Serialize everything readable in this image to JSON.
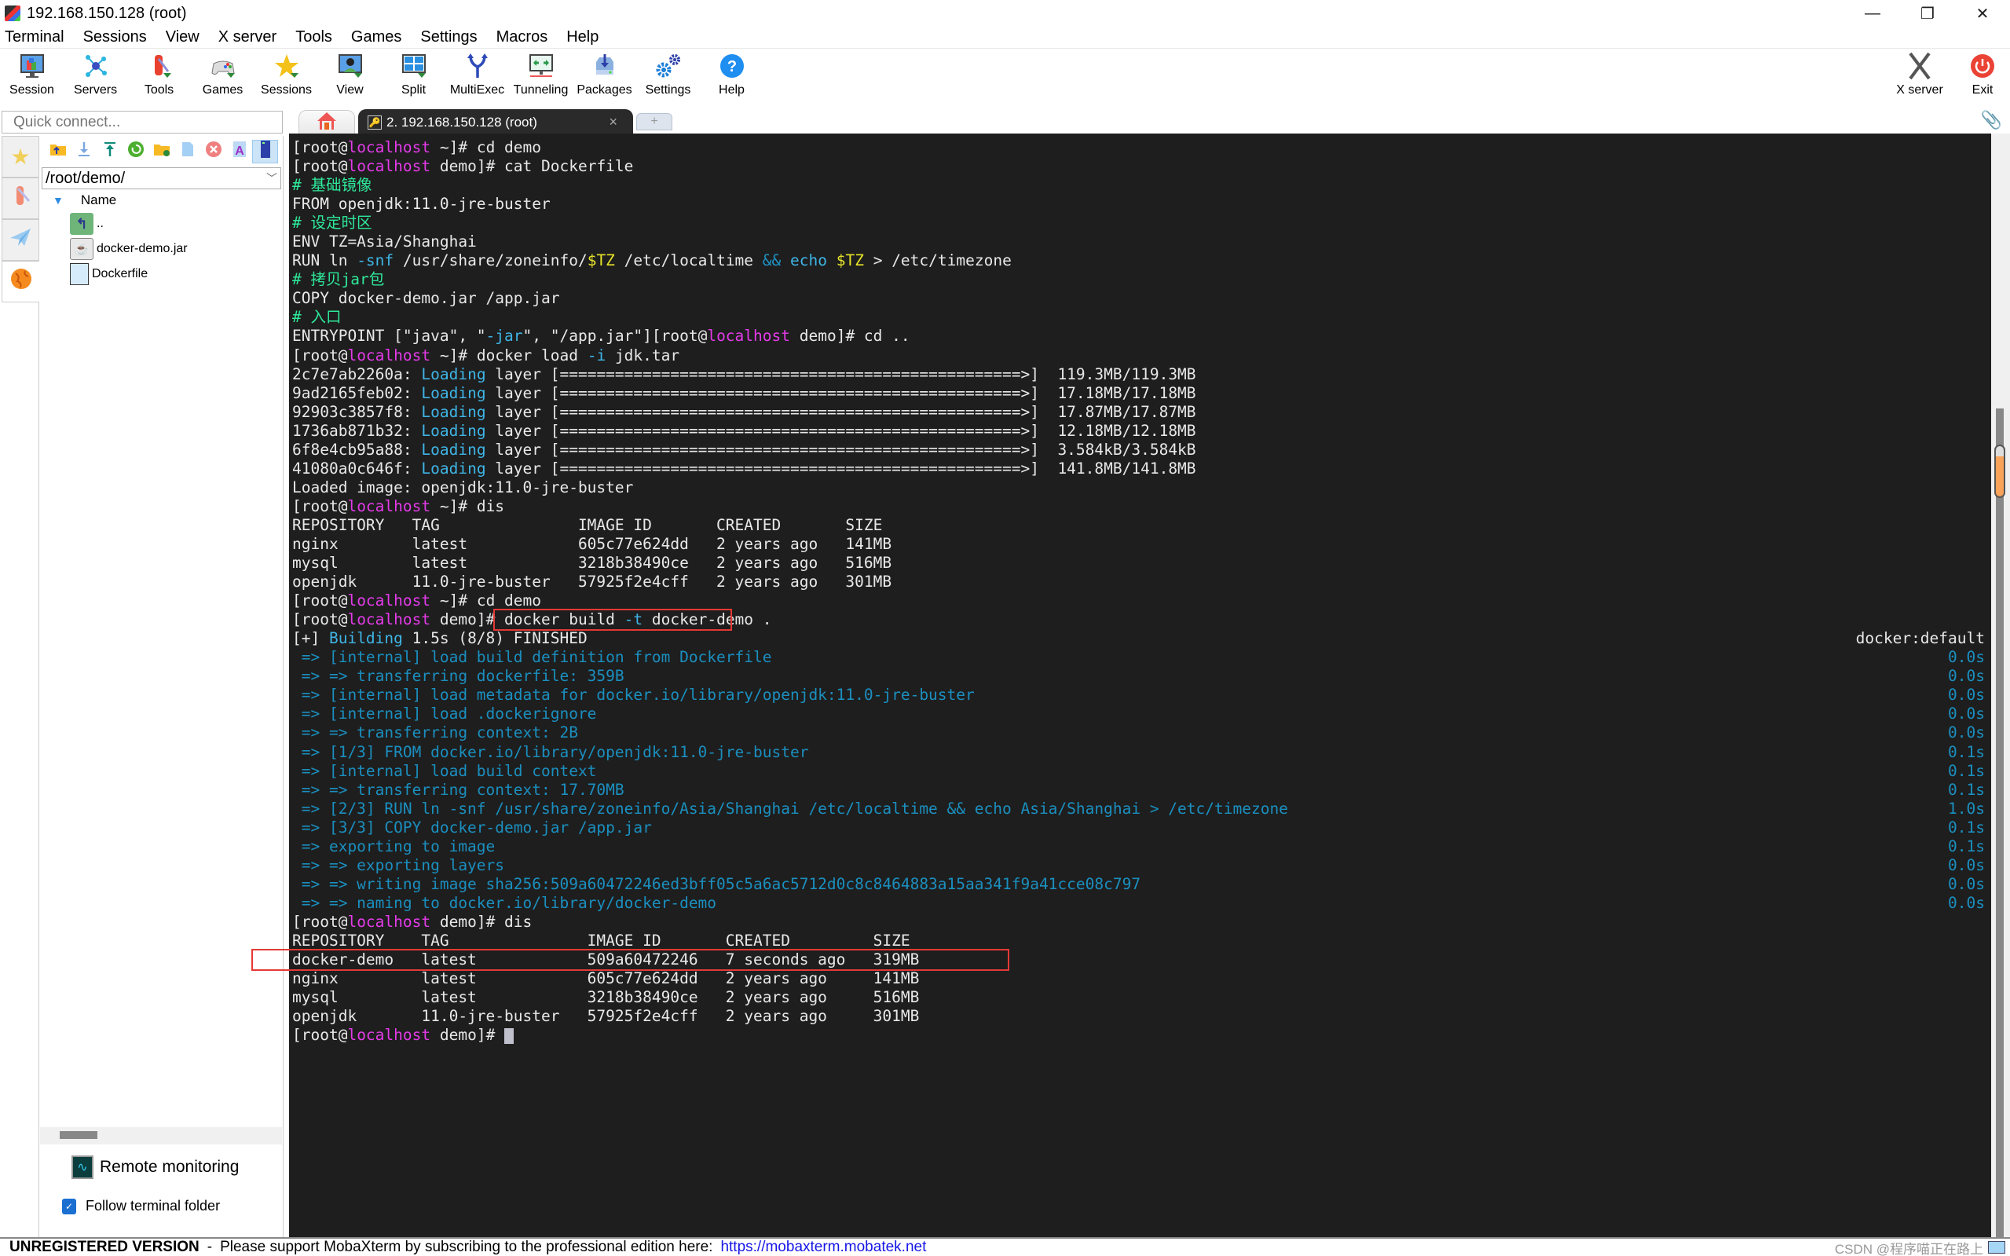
{
  "window": {
    "title": "192.168.150.128 (root)",
    "controls": {
      "minimize": "—",
      "restore": "❐",
      "close": "✕"
    }
  },
  "menu": [
    "Terminal",
    "Sessions",
    "View",
    "X server",
    "Tools",
    "Games",
    "Settings",
    "Macros",
    "Help"
  ],
  "toolbar": {
    "items": [
      {
        "label": "Session",
        "icon": "session-icon"
      },
      {
        "label": "Servers",
        "icon": "servers-icon"
      },
      {
        "label": "Tools",
        "icon": "tools-icon"
      },
      {
        "label": "Games",
        "icon": "games-icon"
      },
      {
        "label": "Sessions",
        "icon": "star-icon"
      },
      {
        "label": "View",
        "icon": "view-icon"
      },
      {
        "label": "Split",
        "icon": "split-icon"
      },
      {
        "label": "MultiExec",
        "icon": "multiexec-icon"
      },
      {
        "label": "Tunneling",
        "icon": "tunneling-icon"
      },
      {
        "label": "Packages",
        "icon": "packages-icon"
      },
      {
        "label": "Settings",
        "icon": "settings-icon"
      },
      {
        "label": "Help",
        "icon": "help-icon"
      }
    ],
    "right": [
      {
        "label": "X server",
        "icon": "x-server-icon"
      },
      {
        "label": "Exit",
        "icon": "power-icon"
      }
    ]
  },
  "quick_connect": {
    "placeholder": "Quick connect..."
  },
  "tabs": {
    "home_icon": "home-icon",
    "session_tab": {
      "label": "2. 192.168.150.128 (root)",
      "close": "×"
    },
    "new_tab": "+"
  },
  "sftp": {
    "path": "/root/demo/",
    "column_header": "Name",
    "files": [
      {
        "name": "..",
        "type": "parent-folder"
      },
      {
        "name": "docker-demo.jar",
        "type": "jar"
      },
      {
        "name": "Dockerfile",
        "type": "file"
      }
    ],
    "remote_monitoring": "Remote monitoring",
    "follow_terminal_folder": {
      "label": "Follow terminal folder",
      "checked": true
    }
  },
  "terminal": {
    "prompt_user": "root",
    "prompt_host": "localhost",
    "lines": [
      {
        "segs": [
          [
            "[root@",
            ""
          ],
          [
            "localhost",
            "host"
          ],
          [
            " ~]# cd demo",
            ""
          ]
        ]
      },
      {
        "segs": [
          [
            "[root@",
            ""
          ],
          [
            "localhost",
            "host"
          ],
          [
            " demo]# cat Dockerfile",
            ""
          ]
        ]
      },
      {
        "segs": [
          [
            "# 基础镜像",
            "cmt"
          ]
        ]
      },
      {
        "segs": [
          [
            "FROM openjdk:11.0-jre-buster",
            ""
          ]
        ]
      },
      {
        "segs": [
          [
            "# 设定时区",
            "cmt"
          ]
        ]
      },
      {
        "segs": [
          [
            "ENV TZ=Asia/Shanghai",
            ""
          ]
        ]
      },
      {
        "segs": [
          [
            "RUN ln ",
            ""
          ],
          [
            "-snf",
            "cyan"
          ],
          [
            " /usr/share/zoneinfo/",
            ""
          ],
          [
            "$TZ",
            "var"
          ],
          [
            " /etc/localtime ",
            ""
          ],
          [
            "&&",
            "blue"
          ],
          [
            " ",
            ""
          ],
          [
            "echo",
            "cyan"
          ],
          [
            " ",
            ""
          ],
          [
            "$TZ",
            "var"
          ],
          [
            " > /etc/timezone",
            ""
          ]
        ]
      },
      {
        "segs": [
          [
            "# 拷贝",
            "cmt"
          ],
          [
            "jar",
            "cmt"
          ],
          [
            "包",
            "cmt"
          ]
        ]
      },
      {
        "segs": [
          [
            "COPY docker-demo.jar /app.jar",
            ""
          ]
        ]
      },
      {
        "segs": [
          [
            "# 入口",
            "cmt"
          ]
        ]
      },
      {
        "segs": [
          [
            "ENTRYPOINT [\"java\", \"",
            ""
          ],
          [
            "-jar",
            "cyan"
          ],
          [
            "\", \"/app.jar\"][root@",
            ""
          ],
          [
            "localhost",
            "host"
          ],
          [
            " demo]# cd ..",
            ""
          ]
        ]
      },
      {
        "segs": [
          [
            "[root@",
            ""
          ],
          [
            "localhost",
            "host"
          ],
          [
            " ~]# docker load ",
            ""
          ],
          [
            "-i",
            "cyan"
          ],
          [
            " jdk.tar",
            ""
          ]
        ]
      },
      {
        "segs": [
          [
            "2c7e7ab2260a: ",
            ""
          ],
          [
            "Loading",
            "cyan"
          ],
          [
            " layer [==================================================>]  119.3MB/119.3MB",
            ""
          ]
        ]
      },
      {
        "segs": [
          [
            "9ad2165feb02: ",
            ""
          ],
          [
            "Loading",
            "cyan"
          ],
          [
            " layer [==================================================>]  17.18MB/17.18MB",
            ""
          ]
        ]
      },
      {
        "segs": [
          [
            "92903c3857f8: ",
            ""
          ],
          [
            "Loading",
            "cyan"
          ],
          [
            " layer [==================================================>]  17.87MB/17.87MB",
            ""
          ]
        ]
      },
      {
        "segs": [
          [
            "1736ab871b32: ",
            ""
          ],
          [
            "Loading",
            "cyan"
          ],
          [
            " layer [==================================================>]  12.18MB/12.18MB",
            ""
          ]
        ]
      },
      {
        "segs": [
          [
            "6f8e4cb95a88: ",
            ""
          ],
          [
            "Loading",
            "cyan"
          ],
          [
            " layer [==================================================>]  3.584kB/3.584kB",
            ""
          ]
        ]
      },
      {
        "segs": [
          [
            "41080a0c646f: ",
            ""
          ],
          [
            "Loading",
            "cyan"
          ],
          [
            " layer [==================================================>]  141.8MB/141.8MB",
            ""
          ]
        ]
      },
      {
        "segs": [
          [
            "Loaded image: openjdk:11.0-jre-buster",
            ""
          ]
        ]
      },
      {
        "segs": [
          [
            "[root@",
            ""
          ],
          [
            "localhost",
            "host"
          ],
          [
            " ~]# dis",
            ""
          ]
        ]
      },
      {
        "segs": [
          [
            "REPOSITORY   TAG               IMAGE ID       CREATED       SIZE",
            ""
          ]
        ]
      },
      {
        "segs": [
          [
            "nginx        latest            605c77e624dd   2 years ago   141MB",
            ""
          ]
        ]
      },
      {
        "segs": [
          [
            "mysql        latest            3218b38490ce   2 years ago   516MB",
            ""
          ]
        ]
      },
      {
        "segs": [
          [
            "openjdk      11.0-jre-buster   57925f2e4cff   2 years ago   301MB",
            ""
          ]
        ]
      },
      {
        "segs": [
          [
            "[root@",
            ""
          ],
          [
            "localhost",
            "host"
          ],
          [
            " ~]# cd demo",
            ""
          ]
        ]
      },
      {
        "segs": [
          [
            "[root@",
            ""
          ],
          [
            "localhost",
            "host"
          ],
          [
            " demo]# docker build ",
            ""
          ],
          [
            "-t",
            "cyan"
          ],
          [
            " docker-demo .",
            ""
          ]
        ],
        "highlight": "build-command"
      },
      {
        "segs": [
          [
            "[+] ",
            ""
          ],
          [
            "Building",
            "cyan"
          ],
          [
            " 1.5s (8/8) FINISHED",
            ""
          ]
        ],
        "right": [
          "docker:default",
          ""
        ]
      },
      {
        "segs": [
          [
            " => [internal] load build definition from Dockerfile",
            "step"
          ]
        ],
        "right": [
          "0.0s",
          "step"
        ]
      },
      {
        "segs": [
          [
            " => => transferring dockerfile: 359B",
            "step"
          ]
        ],
        "right": [
          "0.0s",
          "step"
        ]
      },
      {
        "segs": [
          [
            " => [internal] load metadata for docker.io/library/openjdk:11.0-jre-buster",
            "step"
          ]
        ],
        "right": [
          "0.0s",
          "step"
        ]
      },
      {
        "segs": [
          [
            " => [internal] load .dockerignore",
            "step"
          ]
        ],
        "right": [
          "0.0s",
          "step"
        ]
      },
      {
        "segs": [
          [
            " => => transferring context: 2B",
            "step"
          ]
        ],
        "right": [
          "0.0s",
          "step"
        ]
      },
      {
        "segs": [
          [
            " => [1/3] FROM docker.io/library/openjdk:11.0-jre-buster",
            "step"
          ]
        ],
        "right": [
          "0.1s",
          "step"
        ]
      },
      {
        "segs": [
          [
            " => [internal] load build context",
            "step"
          ]
        ],
        "right": [
          "0.1s",
          "step"
        ]
      },
      {
        "segs": [
          [
            " => => transferring context: 17.70MB",
            "step"
          ]
        ],
        "right": [
          "0.1s",
          "step"
        ]
      },
      {
        "segs": [
          [
            " => [2/3] RUN ln -snf /usr/share/zoneinfo/Asia/Shanghai /etc/localtime && echo Asia/Shanghai > /etc/timezone",
            "step"
          ]
        ],
        "right": [
          "1.0s",
          "step"
        ]
      },
      {
        "segs": [
          [
            " => [3/3] COPY docker-demo.jar /app.jar",
            "step"
          ]
        ],
        "right": [
          "0.1s",
          "step"
        ]
      },
      {
        "segs": [
          [
            " => exporting to image",
            "step"
          ]
        ],
        "right": [
          "0.1s",
          "step"
        ]
      },
      {
        "segs": [
          [
            " => => exporting layers",
            "step"
          ]
        ],
        "right": [
          "0.0s",
          "step"
        ]
      },
      {
        "segs": [
          [
            " => => writing image sha256:509a60472246ed3bff05c5a6ac5712d0c8c8464883a15aa341f9a41cce08c797",
            "step"
          ]
        ],
        "right": [
          "0.0s",
          "step"
        ]
      },
      {
        "segs": [
          [
            " => => naming to docker.io/library/docker-demo",
            "step"
          ]
        ],
        "right": [
          "0.0s",
          "step"
        ]
      },
      {
        "segs": [
          [
            "[root@",
            ""
          ],
          [
            "localhost",
            "host"
          ],
          [
            " demo]# dis",
            ""
          ]
        ]
      },
      {
        "segs": [
          [
            "REPOSITORY    TAG               IMAGE ID       CREATED         SIZE",
            ""
          ]
        ]
      },
      {
        "segs": [
          [
            "docker-demo   latest            509a60472246   7 seconds ago   319MB",
            ""
          ]
        ],
        "highlight": "new-image-row"
      },
      {
        "segs": [
          [
            "nginx         latest            605c77e624dd   2 years ago     141MB",
            ""
          ]
        ]
      },
      {
        "segs": [
          [
            "mysql         latest            3218b38490ce   2 years ago     516MB",
            ""
          ]
        ]
      },
      {
        "segs": [
          [
            "openjdk       11.0-jre-buster   57925f2e4cff   2 years ago     301MB",
            ""
          ]
        ]
      },
      {
        "segs": [
          [
            "[root@",
            ""
          ],
          [
            "localhost",
            "host"
          ],
          [
            " demo]# ",
            ""
          ]
        ],
        "cursor": true
      }
    ]
  },
  "statusbar": {
    "unregistered": "UNREGISTERED VERSION",
    "separator": "-",
    "message": "Please support MobaXterm by subscribing to the professional edition here:",
    "link": "https://mobaxterm.mobatek.net",
    "watermark": "CSDN @程序喵正在路上"
  },
  "colors": {
    "terminal_bg": "#1e1e1e",
    "terminal_fg": "#e8e8e8",
    "prompt_host": "#e33be8",
    "comment": "#2ee89a",
    "flag": "#3fb5e6",
    "variable": "#e6e32a",
    "build_step": "#1b8fbf",
    "highlight_box": "#e53935",
    "link": "#1515e6"
  }
}
